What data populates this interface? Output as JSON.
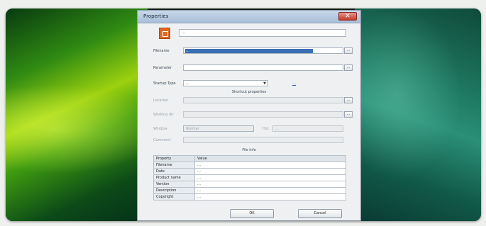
{
  "dialog": {
    "title": "Properties",
    "close_glyph": "✕",
    "app_icon": "app-icon",
    "app_name": "…",
    "fields": {
      "filename_label": "Filename",
      "filename_value": "…",
      "parameter_label": "Parameter",
      "parameter_value": "",
      "startup_type_label": "Startup Type",
      "startup_type_value": "…",
      "link_text": "…"
    },
    "shortcut": {
      "section_title": "Shortcut properties",
      "location_label": "Location",
      "workdir_label": "Working dir",
      "window_label": "Window",
      "window_value": "Normal",
      "hotkey_label": "Hot",
      "hotkey_value": "…",
      "comment_label": "Comment"
    },
    "file_info": {
      "section_title": "File info",
      "columns": [
        "Property",
        "Value"
      ],
      "rows": [
        [
          "Filename",
          "…"
        ],
        [
          "Date",
          "…"
        ],
        [
          "Product name",
          "…"
        ],
        [
          "Version",
          "…"
        ],
        [
          "Description",
          "…"
        ],
        [
          "Copyright",
          "…"
        ]
      ]
    },
    "buttons": {
      "ok": "OK",
      "cancel": "Cancel"
    },
    "browse_glyph": "..."
  },
  "colors": {
    "wallpaper_left": "#7ec20f",
    "wallpaper_right": "#1f7a62",
    "dialog_bg": "#eef0f2",
    "highlight": "#3a6fb3"
  }
}
